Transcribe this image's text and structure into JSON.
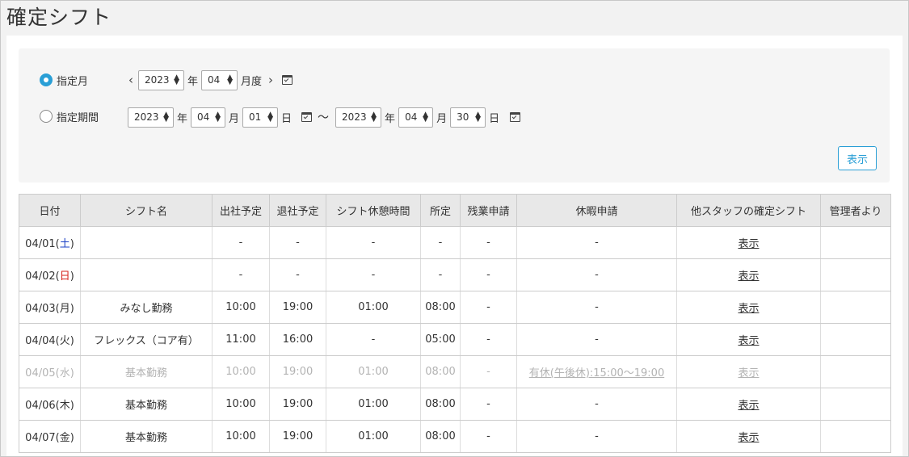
{
  "page": {
    "title": "確定シフト"
  },
  "filter": {
    "month_mode": {
      "label": "指定月",
      "selected": true,
      "year": "2023",
      "year_unit": "年",
      "month": "04",
      "month_unit": "月度"
    },
    "period_mode": {
      "label": "指定期間",
      "selected": false,
      "from": {
        "year": "2023",
        "month": "04",
        "day": "01"
      },
      "to": {
        "year": "2023",
        "month": "04",
        "day": "30"
      },
      "year_unit": "年",
      "month_unit": "月",
      "day_unit": "日",
      "separator": "〜"
    },
    "show_button": "表示"
  },
  "table": {
    "headers": [
      "日付",
      "シフト名",
      "出社予定",
      "退社予定",
      "シフト休憩時間",
      "所定",
      "残業申請",
      "休暇申請",
      "他スタッフの確定シフト",
      "管理者より"
    ],
    "rows": [
      {
        "date": "04/01(",
        "dow": "土",
        "dow_end": ")",
        "dow_type": "sat",
        "shift": "",
        "in": "-",
        "out": "-",
        "break": "-",
        "scheduled": "-",
        "overtime": "-",
        "leave": "-",
        "others": "表示",
        "admin": "",
        "muted": false
      },
      {
        "date": "04/02(",
        "dow": "日",
        "dow_end": ")",
        "dow_type": "sun",
        "shift": "",
        "in": "-",
        "out": "-",
        "break": "-",
        "scheduled": "-",
        "overtime": "-",
        "leave": "-",
        "others": "表示",
        "admin": "",
        "muted": false
      },
      {
        "date": "04/03(",
        "dow": "月",
        "dow_end": ")",
        "dow_type": "",
        "shift": "みなし勤務",
        "in": "10:00",
        "out": "19:00",
        "break": "01:00",
        "scheduled": "08:00",
        "overtime": "-",
        "leave": "-",
        "others": "表示",
        "admin": "",
        "muted": false
      },
      {
        "date": "04/04(",
        "dow": "火",
        "dow_end": ")",
        "dow_type": "",
        "shift": "フレックス（コア有）",
        "in": "11:00",
        "out": "16:00",
        "break": "-",
        "scheduled": "05:00",
        "overtime": "-",
        "leave": "-",
        "others": "表示",
        "admin": "",
        "muted": false
      },
      {
        "date": "04/05(",
        "dow": "水",
        "dow_end": ")",
        "dow_type": "",
        "shift": "基本勤務",
        "in": "10:00",
        "out": "19:00",
        "break": "01:00",
        "scheduled": "08:00",
        "overtime": "-",
        "leave": "有休(午後休):15:00〜19:00",
        "leave_link": true,
        "others": "表示",
        "admin": "",
        "muted": true
      },
      {
        "date": "04/06(",
        "dow": "木",
        "dow_end": ")",
        "dow_type": "",
        "shift": "基本勤務",
        "in": "10:00",
        "out": "19:00",
        "break": "01:00",
        "scheduled": "08:00",
        "overtime": "-",
        "leave": "-",
        "others": "表示",
        "admin": "",
        "muted": false
      },
      {
        "date": "04/07(",
        "dow": "金",
        "dow_end": ")",
        "dow_type": "",
        "shift": "基本勤務",
        "in": "10:00",
        "out": "19:00",
        "break": "01:00",
        "scheduled": "08:00",
        "overtime": "-",
        "leave": "-",
        "others": "表示",
        "admin": "",
        "muted": false
      }
    ]
  },
  "colors": {
    "accent": "#2a9fd6",
    "saturday": "#1a3fc4",
    "sunday": "#d6211b",
    "muted": "#b3b3b3"
  }
}
